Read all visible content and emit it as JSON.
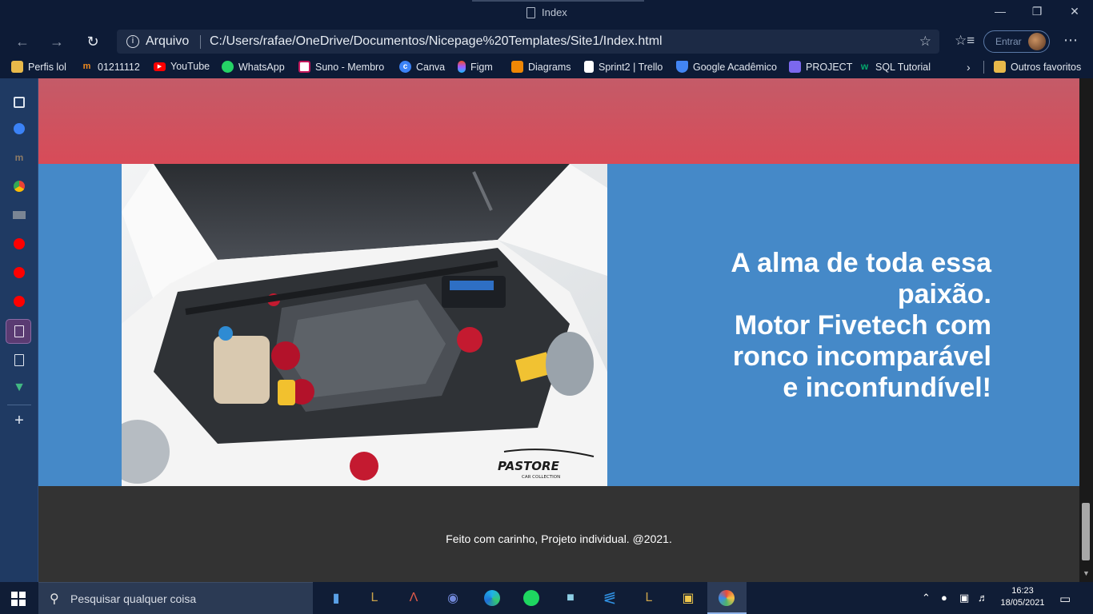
{
  "window": {
    "title": "Index"
  },
  "address_bar": {
    "scheme_label": "Arquivo",
    "url": "C:/Users/rafae/OneDrive/Documentos/Nicepage%20Templates/Site1/Index.html"
  },
  "profile": {
    "signin_label": "Entrar"
  },
  "bookmarks": [
    {
      "label": "Perfis lol",
      "icon": "folder-icon",
      "color": "#e8b94a"
    },
    {
      "label": "01211112",
      "icon": "moodle-icon",
      "color": "#f18b1e"
    },
    {
      "label": "YouTube",
      "icon": "youtube-icon",
      "color": "#ff0000"
    },
    {
      "label": "WhatsApp",
      "icon": "whatsapp-icon",
      "color": "#25d366"
    },
    {
      "label": "Suno - Membro",
      "icon": "suno-icon",
      "color": "#c2185b"
    },
    {
      "label": "Canva",
      "icon": "canva-icon",
      "color": "#3b82f6"
    },
    {
      "label": "Figm",
      "icon": "figma-icon",
      "color": "#a259ff"
    },
    {
      "label": "Diagrams",
      "icon": "diagrams-icon",
      "color": "#f08705"
    },
    {
      "label": "Sprint2 | Trello",
      "icon": "trello-icon",
      "color": "#ffffff"
    },
    {
      "label": "Google Acadêmico",
      "icon": "scholar-icon",
      "color": "#4285f4"
    },
    {
      "label": "PROJECT",
      "icon": "project-icon",
      "color": "#7b68ee"
    },
    {
      "label": "SQL Tutorial",
      "icon": "w3-icon",
      "color": "#04aa6d"
    }
  ],
  "bookmarks_other": "Outros favoritos",
  "content": {
    "headline_lines": [
      "A alma de toda essa",
      "paixão.",
      "Motor Fivetech com",
      "ronco incomparável",
      "e inconfundível!"
    ],
    "image_logo": "PASTORE",
    "image_logo_sub": "CAR COLLECTION",
    "footer": "Feito com carinho, Projeto individual. @2021."
  },
  "colors": {
    "hero_pink": "#d84b58",
    "section_blue": "#4589c8",
    "footer_dark": "#333333"
  },
  "taskbar": {
    "search_placeholder": "Pesquisar qualquer coisa",
    "time": "16:23",
    "date": "18/05/2021"
  }
}
